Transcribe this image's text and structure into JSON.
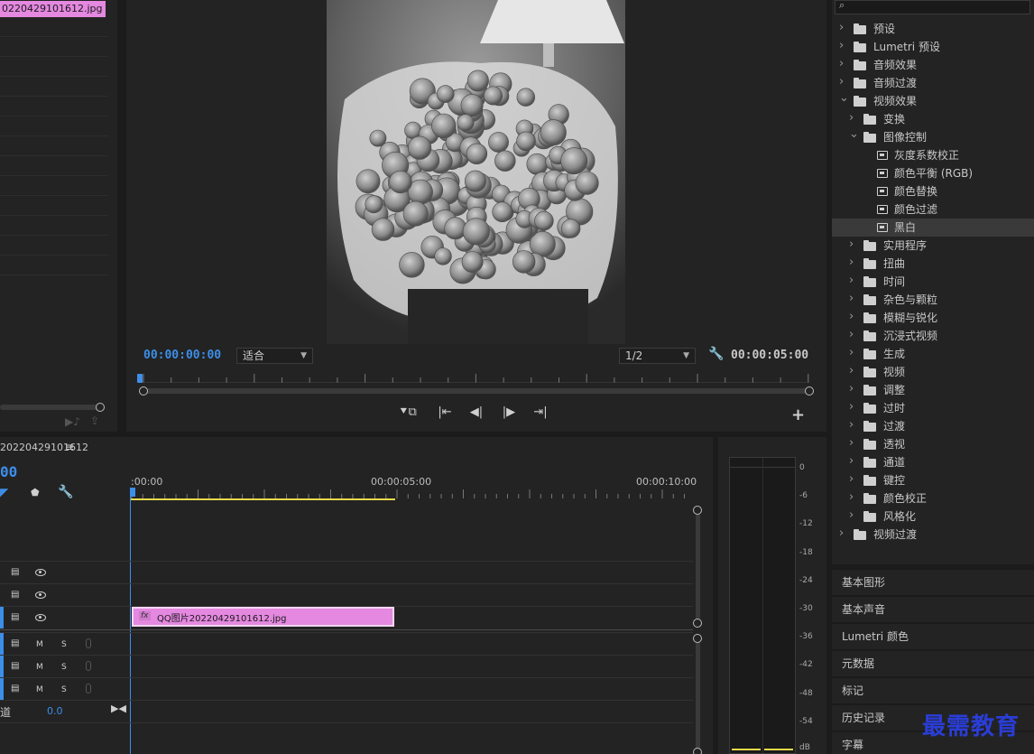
{
  "project": {
    "selected_item": "0220429101612.jpg"
  },
  "monitor": {
    "current_time": "00:00:00:00",
    "fit": "适合",
    "resolution": "1/2",
    "duration": "00:00:05:00",
    "add_button": "+"
  },
  "effects": {
    "tree": [
      {
        "label": "预设",
        "level": 0,
        "open": false,
        "icon": "preset-folder-icon"
      },
      {
        "label": "Lumetri 预设",
        "level": 0,
        "open": false,
        "icon": "preset-folder-icon"
      },
      {
        "label": "音频效果",
        "level": 0,
        "open": false,
        "icon": "folder-icon"
      },
      {
        "label": "音频过渡",
        "level": 0,
        "open": false,
        "icon": "folder-icon"
      },
      {
        "label": "视频效果",
        "level": 0,
        "open": true,
        "icon": "folder-icon"
      },
      {
        "label": "变换",
        "level": 1,
        "open": false,
        "icon": "folder-icon"
      },
      {
        "label": "图像控制",
        "level": 1,
        "open": true,
        "icon": "folder-icon"
      },
      {
        "label": "灰度系数校正",
        "level": 2,
        "icon": "effect-icon"
      },
      {
        "label": "颜色平衡 (RGB)",
        "level": 2,
        "icon": "effect-icon"
      },
      {
        "label": "颜色替换",
        "level": 2,
        "icon": "effect-icon"
      },
      {
        "label": "颜色过滤",
        "level": 2,
        "icon": "effect-icon"
      },
      {
        "label": "黑白",
        "level": 2,
        "icon": "effect-icon",
        "selected": true
      },
      {
        "label": "实用程序",
        "level": 1,
        "open": false,
        "icon": "folder-icon"
      },
      {
        "label": "扭曲",
        "level": 1,
        "open": false,
        "icon": "folder-icon"
      },
      {
        "label": "时间",
        "level": 1,
        "open": false,
        "icon": "folder-icon"
      },
      {
        "label": "杂色与颗粒",
        "level": 1,
        "open": false,
        "icon": "folder-icon"
      },
      {
        "label": "模糊与锐化",
        "level": 1,
        "open": false,
        "icon": "folder-icon"
      },
      {
        "label": "沉浸式视频",
        "level": 1,
        "open": false,
        "icon": "folder-icon"
      },
      {
        "label": "生成",
        "level": 1,
        "open": false,
        "icon": "folder-icon"
      },
      {
        "label": "视频",
        "level": 1,
        "open": false,
        "icon": "folder-icon"
      },
      {
        "label": "调整",
        "level": 1,
        "open": false,
        "icon": "folder-icon"
      },
      {
        "label": "过时",
        "level": 1,
        "open": false,
        "icon": "folder-icon"
      },
      {
        "label": "过渡",
        "level": 1,
        "open": false,
        "icon": "folder-icon"
      },
      {
        "label": "透视",
        "level": 1,
        "open": false,
        "icon": "folder-icon"
      },
      {
        "label": "通道",
        "level": 1,
        "open": false,
        "icon": "folder-icon"
      },
      {
        "label": "键控",
        "level": 1,
        "open": false,
        "icon": "folder-icon"
      },
      {
        "label": "颜色校正",
        "level": 1,
        "open": false,
        "icon": "folder-icon"
      },
      {
        "label": "风格化",
        "level": 1,
        "open": false,
        "icon": "folder-icon"
      },
      {
        "label": "视频过渡",
        "level": 0,
        "open": false,
        "icon": "folder-icon"
      }
    ]
  },
  "panels": [
    "基本图形",
    "基本声音",
    "Lumetri 颜色",
    "元数据",
    "标记",
    "历史记录",
    "字幕"
  ],
  "timeline": {
    "sequence_name": "20220429101612",
    "menu_icon": "≡",
    "timecode_fragment": "00",
    "ruler": [
      ":00:00",
      "00:00:05:00",
      "00:00:10:00"
    ],
    "clip_name": "QQ图片20220429101612.jpg",
    "clip_fx": "fx",
    "audio_m": "M",
    "audio_s": "S",
    "master_label": "道",
    "master_value": "0.0"
  },
  "meter": {
    "db_labels": [
      "0",
      "-6",
      "-12",
      "-18",
      "-24",
      "-30",
      "-36",
      "-42",
      "-48",
      "-54",
      "dB"
    ]
  },
  "watermark": "最需教育"
}
